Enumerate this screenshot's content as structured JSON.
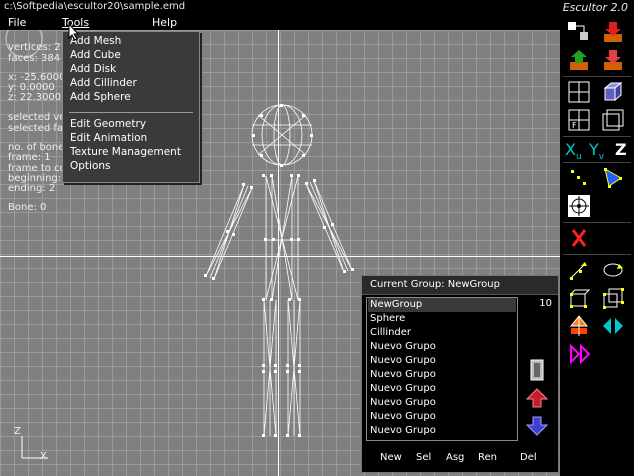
{
  "window": {
    "path": "c:\\Softpedia\\escultor20\\sample.emd",
    "app_title": "Escultor 2.0"
  },
  "menu": {
    "file": "File",
    "tools": "Tools",
    "help": "Help"
  },
  "tools_menu": {
    "add_mesh": "Add Mesh",
    "add_cube": "Add Cube",
    "add_disk": "Add Disk",
    "add_cillinder": "Add Cillinder",
    "add_sphere": "Add Sphere",
    "edit_geometry": "Edit Geometry",
    "edit_animation": "Edit Animation",
    "texture_management": "Texture Management",
    "options": "Options"
  },
  "hud": {
    "vertices": "vertices: 21",
    "faces": "faces: 384",
    "x": "x: -25.6000",
    "y": "y: 0.0000",
    "z": "z: 22.3000",
    "selected_vertices": "selected ver",
    "selected_faces": "selected face",
    "no_bones": "no. of bone",
    "frame": "frame: 1",
    "frame_to_copy": "frame to co",
    "beginning": "beginning:",
    "ending": "ending: 2",
    "bone": "Bone: 0"
  },
  "axes": {
    "z_label": "Z",
    "x_label": "X"
  },
  "group_panel": {
    "title": "Current Group: NewGroup",
    "count": "10",
    "items": [
      "NewGroup",
      "Sphere",
      "Cillinder",
      "Nuevo Grupo",
      "Nuevo Grupo",
      "Nuevo Grupo",
      "Nuevo Grupo",
      "Nuevo Grupo",
      "Nuevo Grupo",
      "Nuevo Grupo"
    ],
    "buttons": {
      "new": "New",
      "sel": "Sel",
      "asg": "Asg",
      "ren": "Ren",
      "del": "Del"
    }
  },
  "toolbar": {
    "axis_x": "X",
    "axis_x_sub": "u",
    "axis_y": "Y",
    "axis_y_sub": "v",
    "axis_z": "Z"
  },
  "colors": {
    "accent_cyan": "#00c8c8",
    "magenta": "#ff00ff",
    "selection_yellow": "#ffff00",
    "delete_red": "#ff2020"
  }
}
